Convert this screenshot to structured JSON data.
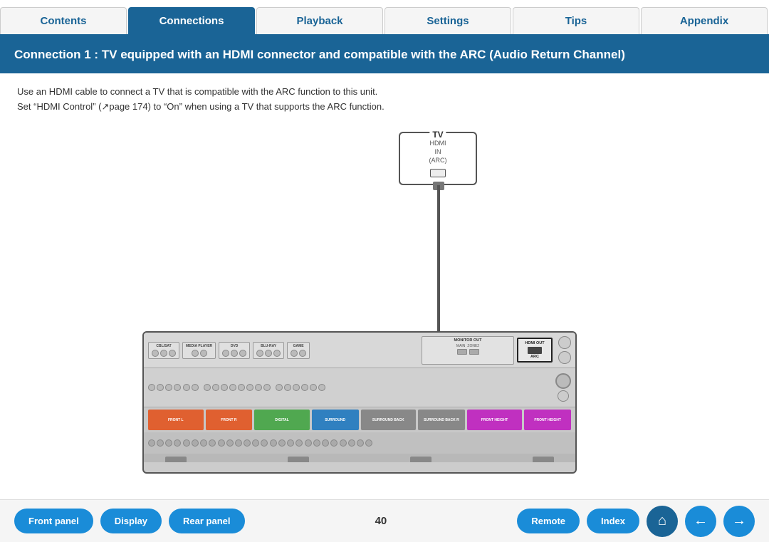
{
  "nav": {
    "tabs": [
      {
        "id": "contents",
        "label": "Contents",
        "active": false
      },
      {
        "id": "connections",
        "label": "Connections",
        "active": true
      },
      {
        "id": "playback",
        "label": "Playback",
        "active": false
      },
      {
        "id": "settings",
        "label": "Settings",
        "active": false
      },
      {
        "id": "tips",
        "label": "Tips",
        "active": false
      },
      {
        "id": "appendix",
        "label": "Appendix",
        "active": false
      }
    ]
  },
  "page": {
    "title": "Connection 1 : TV equipped with an HDMI connector and compatible with the ARC (Audio Return Channel)",
    "description_line1": "Use an HDMI cable to connect a TV that is compatible with the ARC function to this unit.",
    "description_line2": "Set “HDMI Control” (↗page 174) to “On” when using a TV that supports the ARC function.",
    "page_number": "40"
  },
  "diagram": {
    "tv_label": "TV",
    "hdmi_port_label": "HDMI\nIN\n(ARC)",
    "hdmi_out_label": "HDMI OUT",
    "arc_label": "ARC",
    "monitor_label": "MONITOR"
  },
  "bottom_nav": {
    "front_panel": "Front panel",
    "display": "Display",
    "rear_panel": "Rear panel",
    "remote": "Remote",
    "index": "Index",
    "home_icon": "⌂",
    "back_icon": "←",
    "forward_icon": "→"
  },
  "colors": {
    "primary": "#1a6496",
    "button": "#1a8cd8",
    "header_bg": "#1a6496",
    "tab_active": "#1a6496"
  }
}
